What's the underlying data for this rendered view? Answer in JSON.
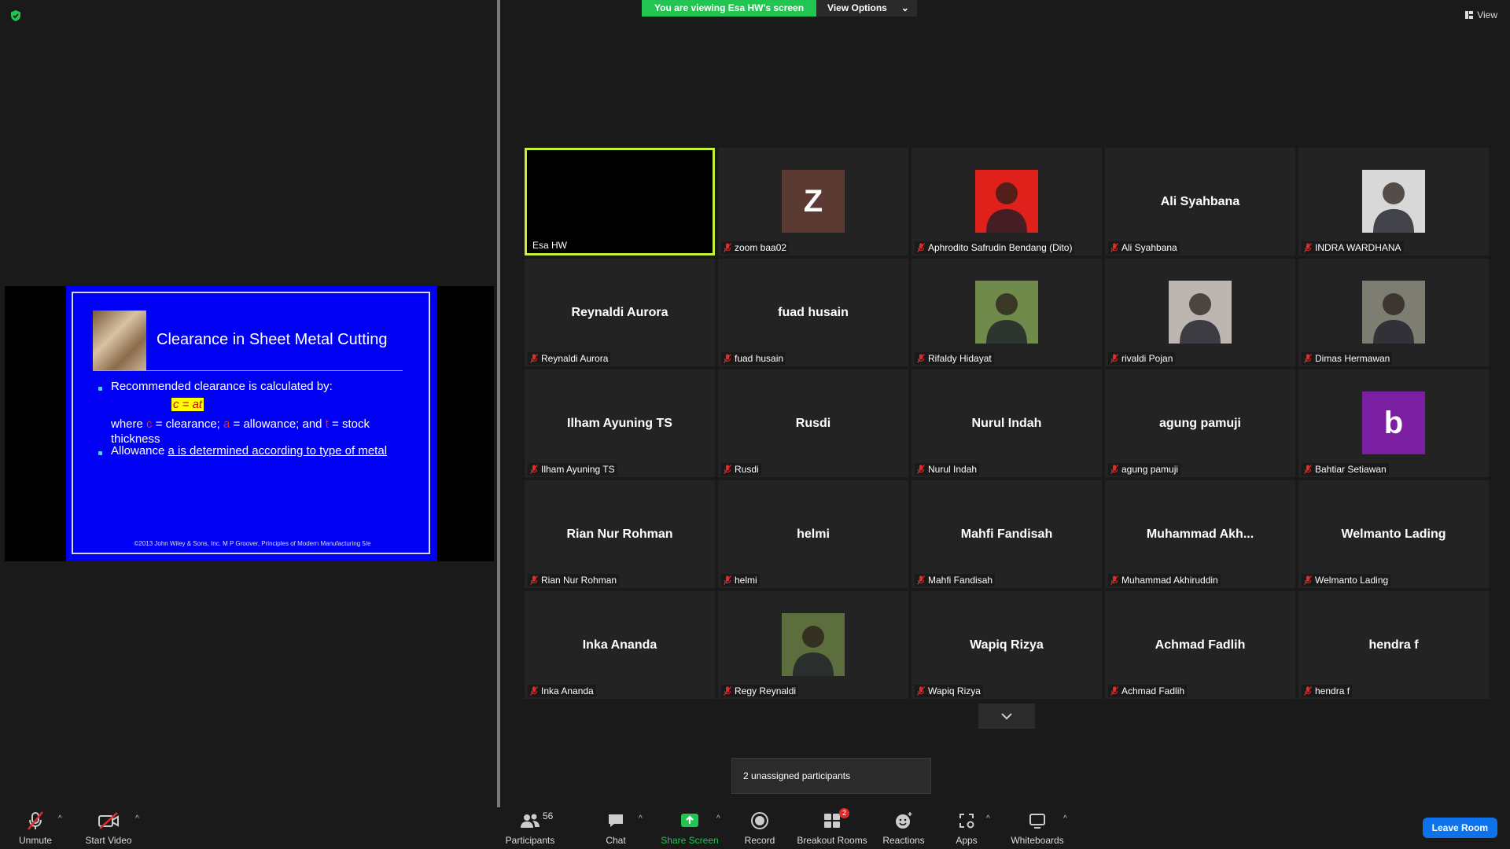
{
  "banner": {
    "viewing": "You are viewing Esa HW's screen",
    "view_options": "View Options"
  },
  "view_button": "View",
  "slide": {
    "title": "Clearance in Sheet Metal Cutting",
    "bullet1": "Recommended clearance is calculated by:",
    "formula": "c = at",
    "where_prefix": "where",
    "c_var": "c",
    "c_def": "= clearance;",
    "a_var": "a",
    "a_def": "= allowance; and",
    "t_var": "t",
    "t_def": "= stock",
    "thickness": "thickness",
    "bullet2_prefix": "Allowance",
    "bullet2_link": "a is determined according to type of metal",
    "footer": "©2013 John Wiley & Sons, Inc. M P Groover, Principles of Modern Manufacturing 5/e"
  },
  "tiles": [
    {
      "label": "Esa HW",
      "center": "",
      "kind": "active"
    },
    {
      "label": "zoom baa02",
      "center": "",
      "kind": "letter",
      "letter": "Z",
      "color": "#5b3a32"
    },
    {
      "label": "Aphrodito Safrudin Bendang (Dito)",
      "center": "",
      "kind": "photo",
      "color": "#e0201b"
    },
    {
      "label": "Ali Syahbana",
      "center": "Ali Syahbana",
      "kind": "name"
    },
    {
      "label": "INDRA WARDHANA",
      "center": "",
      "kind": "photo",
      "color": "#d8d8d8"
    },
    {
      "label": "Reynaldi Aurora",
      "center": "Reynaldi Aurora",
      "kind": "name"
    },
    {
      "label": "fuad husain",
      "center": "fuad husain",
      "kind": "name"
    },
    {
      "label": "Rifaldy Hidayat",
      "center": "",
      "kind": "photo",
      "color": "#6f8a4a"
    },
    {
      "label": "rivaldi Pojan",
      "center": "",
      "kind": "photo",
      "color": "#bdb6b0"
    },
    {
      "label": "Dimas Hermawan",
      "center": "",
      "kind": "photo",
      "color": "#7d7d72"
    },
    {
      "label": "Ilham Ayuning TS",
      "center": "Ilham Ayuning TS",
      "kind": "name"
    },
    {
      "label": "Rusdi",
      "center": "Rusdi",
      "kind": "name"
    },
    {
      "label": "Nurul Indah",
      "center": "Nurul Indah",
      "kind": "name"
    },
    {
      "label": "agung pamuji",
      "center": "agung pamuji",
      "kind": "name"
    },
    {
      "label": "Bahtiar Setiawan",
      "center": "",
      "kind": "letter",
      "letter": "b",
      "color": "#7b1fa2"
    },
    {
      "label": "Rian Nur Rohman",
      "center": "Rian Nur Rohman",
      "kind": "name"
    },
    {
      "label": "helmi",
      "center": "helmi",
      "kind": "name"
    },
    {
      "label": "Mahfi Fandisah",
      "center": "Mahfi Fandisah",
      "kind": "name"
    },
    {
      "label": "Muhammad Akhiruddin",
      "center": "Muhammad  Akh...",
      "kind": "name"
    },
    {
      "label": "Welmanto Lading",
      "center": "Welmanto Lading",
      "kind": "name"
    },
    {
      "label": "Inka Ananda",
      "center": "Inka Ananda",
      "kind": "name"
    },
    {
      "label": "Regy Reynaldi",
      "center": "",
      "kind": "photo",
      "color": "#5c6e3e"
    },
    {
      "label": "Wapiq Rizya",
      "center": "Wapiq Rizya",
      "kind": "name"
    },
    {
      "label": "Achmad Fadlih",
      "center": "Achmad Fadlih",
      "kind": "name"
    },
    {
      "label": "hendra f",
      "center": "hendra f",
      "kind": "name"
    }
  ],
  "toast": "2 unassigned participants",
  "toolbar": {
    "unmute": "Unmute",
    "start_video": "Start Video",
    "participants": "Participants",
    "participants_count": "56",
    "chat": "Chat",
    "share_screen": "Share Screen",
    "record": "Record",
    "breakout_rooms": "Breakout Rooms",
    "breakout_badge": "2",
    "reactions": "Reactions",
    "apps": "Apps",
    "whiteboards": "Whiteboards",
    "leave_room": "Leave Room"
  },
  "colors": {
    "accent_green": "#23c552",
    "active_border": "#c7f03a",
    "leave_blue": "#0e72ed",
    "slide_blue": "#0000f5"
  }
}
